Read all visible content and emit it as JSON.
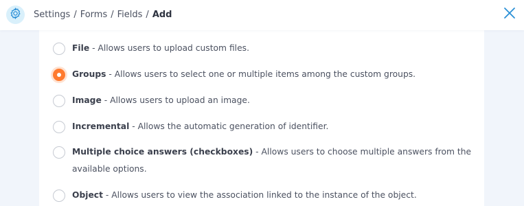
{
  "breadcrumb": {
    "items": [
      "Settings",
      "Forms",
      "Fields"
    ],
    "separator": "/",
    "current": "Add"
  },
  "icons": {
    "settings": "gear-icon",
    "close": "close-icon"
  },
  "colors": {
    "accent": "#ff7a2e",
    "close_icon": "#2a8fd6",
    "gear_icon": "#2a8fd6",
    "page_background": "#f1f5fb"
  },
  "options": [
    {
      "name": "File",
      "description": " - Allows users to upload custom files.",
      "selected": false
    },
    {
      "name": "Groups",
      "description": " - Allows users to select one or multiple items among the custom groups.",
      "selected": true
    },
    {
      "name": "Image",
      "description": " - Allows users to upload an image.",
      "selected": false
    },
    {
      "name": "Incremental",
      "description": " - Allows the automatic generation of identifier.",
      "selected": false
    },
    {
      "name": "Multiple choice answers (checkboxes)",
      "description": " - Allows users to choose multiple answers from the available options.",
      "selected": false
    },
    {
      "name": "Object",
      "description": " - Allows users to view the association linked to the instance of the object.",
      "selected": false
    }
  ]
}
